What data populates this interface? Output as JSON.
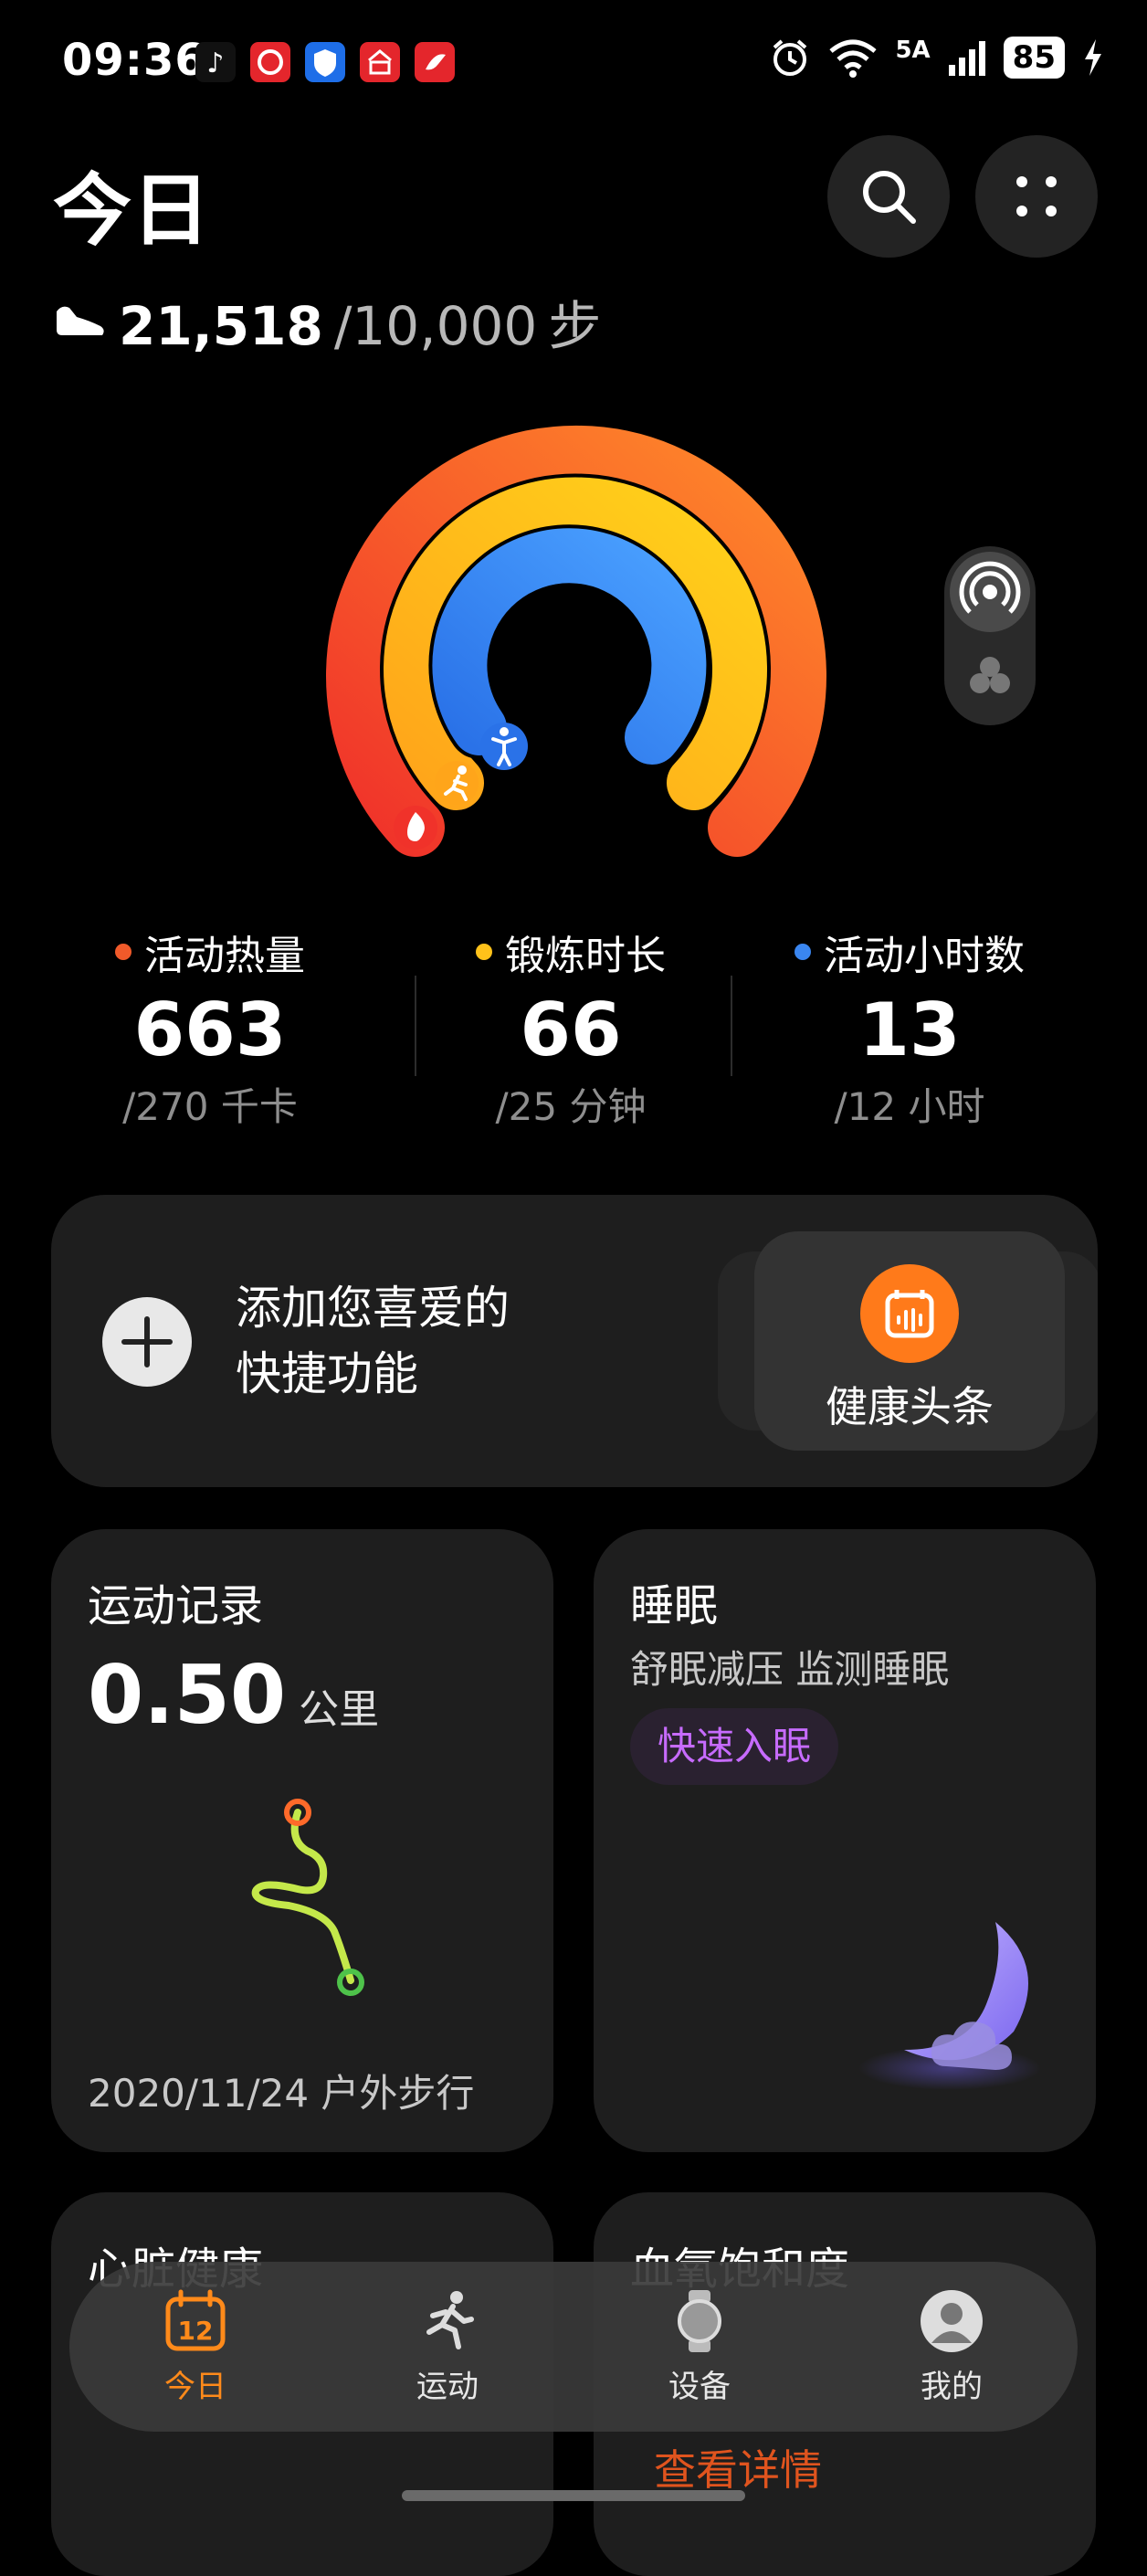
{
  "status_bar": {
    "time": "09:36",
    "network": "5A",
    "battery": "85",
    "app_icon_colors": [
      "#111111",
      "#e4262c",
      "#1e6ee8",
      "#e4262c",
      "#e4262c"
    ],
    "icons": [
      "tiktok-icon",
      "app-icon",
      "shield-app-icon",
      "bank-app-icon",
      "app-icon",
      "alarm-icon",
      "wifi-icon",
      "signal-icon",
      "battery-icon",
      "charging-icon"
    ]
  },
  "header": {
    "title": "今日",
    "steps_value": "21,518",
    "steps_goal": "/10,000",
    "steps_unit": "步"
  },
  "rings": {
    "calories_progress": 2.46,
    "exercise_progress": 2.64,
    "hours_progress": 1.08,
    "colors": {
      "calories": "#f05a2a",
      "exercise": "#ffc21a",
      "hours": "#3a86f0"
    }
  },
  "stats": [
    {
      "label": "活动热量",
      "value": "663",
      "target": "/270 千卡",
      "color": "#f05a2a"
    },
    {
      "label": "锻炼时长",
      "value": "66",
      "target": "/25 分钟",
      "color": "#ffc21a"
    },
    {
      "label": "活动小时数",
      "value": "13",
      "target": "/12 小时",
      "color": "#3a86f0"
    }
  ],
  "shortcut_card": {
    "add_text_line1": "添加您喜爱的",
    "add_text_line2": "快捷功能",
    "feature_label": "健康头条",
    "feature_color": "#ff7a1a"
  },
  "exercise_card": {
    "title": "运动记录",
    "distance_value": "0.50",
    "distance_unit": "公里",
    "record_text": "2020/11/24 户外步行"
  },
  "sleep_card": {
    "title": "睡眠",
    "subtitle": "舒眠减压 监测睡眠",
    "action_label": "快速入眠"
  },
  "heart_card": {
    "title": "心脏健康"
  },
  "spo2_card": {
    "title": "血氧饱和度",
    "action_label": "查看详情"
  },
  "bottom_nav": {
    "items": [
      {
        "label": "今日",
        "calendar_day": "12",
        "active": true
      },
      {
        "label": "运动",
        "active": false
      },
      {
        "label": "设备",
        "active": false
      },
      {
        "label": "我的",
        "active": false
      }
    ],
    "active_color": "#ff8a1a"
  }
}
